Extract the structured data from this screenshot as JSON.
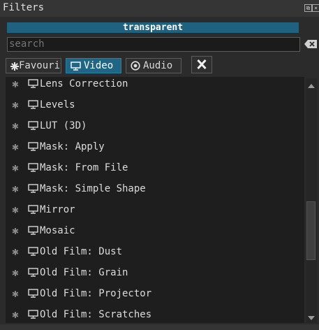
{
  "panel": {
    "title": "Filters"
  },
  "banner": {
    "text": "transparent"
  },
  "search": {
    "placeholder": "search",
    "value": ""
  },
  "tabs": [
    {
      "label": "Favourite",
      "icon": "star-icon",
      "active": false
    },
    {
      "label": "Video",
      "icon": "monitor-icon",
      "active": true
    },
    {
      "label": "Audio",
      "icon": "speaker-icon",
      "active": false
    }
  ],
  "close_label": "✕",
  "filters": [
    {
      "label": "Lens Correction"
    },
    {
      "label": "Levels"
    },
    {
      "label": "LUT (3D)"
    },
    {
      "label": "Mask: Apply"
    },
    {
      "label": "Mask: From File"
    },
    {
      "label": "Mask: Simple Shape"
    },
    {
      "label": "Mirror"
    },
    {
      "label": "Mosaic"
    },
    {
      "label": "Old Film: Dust"
    },
    {
      "label": "Old Film: Grain"
    },
    {
      "label": "Old Film: Projector"
    },
    {
      "label": "Old Film: Scratches"
    }
  ],
  "colors": {
    "accent": "#1f6685",
    "background": "#2b2b2b",
    "list_bg": "#1e1e1e"
  }
}
